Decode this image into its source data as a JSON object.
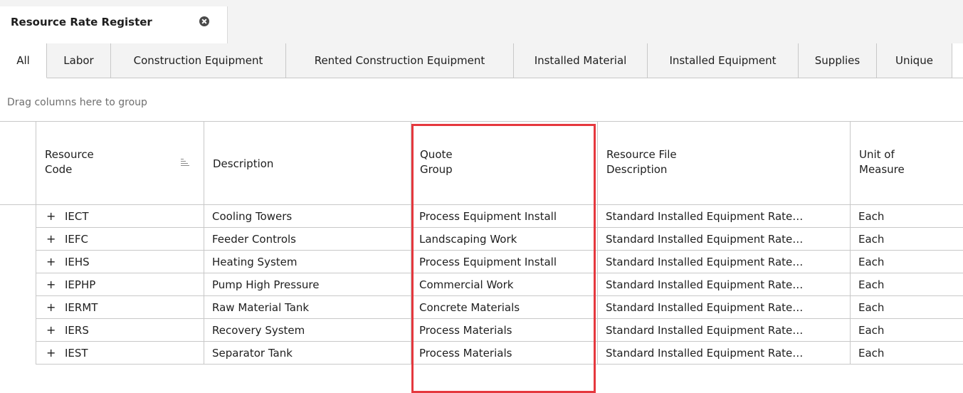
{
  "document_tab": {
    "title": "Resource Rate Register",
    "close_icon": "close-circle-icon"
  },
  "category_tabs": [
    {
      "label": "All",
      "active": true
    },
    {
      "label": "Labor",
      "active": false
    },
    {
      "label": "Construction Equipment",
      "active": false
    },
    {
      "label": "Rented Construction Equipment",
      "active": false
    },
    {
      "label": "Installed Material",
      "active": false
    },
    {
      "label": "Installed Equipment",
      "active": false
    },
    {
      "label": "Supplies",
      "active": false
    },
    {
      "label": "Unique",
      "active": false
    }
  ],
  "group_panel": {
    "hint": "Drag columns here to group"
  },
  "columns": [
    {
      "key": "code",
      "label": "Resource\nCode",
      "sort_icon": "sort-ascending-icon"
    },
    {
      "key": "description",
      "label": "Description"
    },
    {
      "key": "quote_group",
      "label": "Quote\nGroup"
    },
    {
      "key": "resource_file",
      "label": "Resource File\nDescription"
    },
    {
      "key": "uom",
      "label": "Unit of\nMeasure"
    }
  ],
  "rows": [
    {
      "code": "IECT",
      "description": "Cooling Towers",
      "quote_group": "Process Equipment Install",
      "resource_file": "Standard Installed Equipment Rate…",
      "uom": "Each"
    },
    {
      "code": "IEFC",
      "description": "Feeder Controls",
      "quote_group": "Landscaping Work",
      "resource_file": "Standard Installed Equipment Rate…",
      "uom": "Each"
    },
    {
      "code": "IEHS",
      "description": "Heating System",
      "quote_group": "Process Equipment Install",
      "resource_file": "Standard Installed Equipment Rate…",
      "uom": "Each"
    },
    {
      "code": "IEPHP",
      "description": "Pump High Pressure",
      "quote_group": "Commercial Work",
      "resource_file": "Standard Installed Equipment Rate…",
      "uom": "Each"
    },
    {
      "code": "IERMT",
      "description": "Raw Material Tank",
      "quote_group": "Concrete Materials",
      "resource_file": "Standard Installed Equipment Rate…",
      "uom": "Each"
    },
    {
      "code": "IERS",
      "description": "Recovery System",
      "quote_group": "Process Materials",
      "resource_file": "Standard Installed Equipment Rate…",
      "uom": "Each"
    },
    {
      "code": "IEST",
      "description": "Separator Tank",
      "quote_group": "Process Materials",
      "resource_file": "Standard Installed Equipment Rate…",
      "uom": "Each"
    }
  ],
  "expand_symbol": "+",
  "highlight_color": "#e5383e"
}
